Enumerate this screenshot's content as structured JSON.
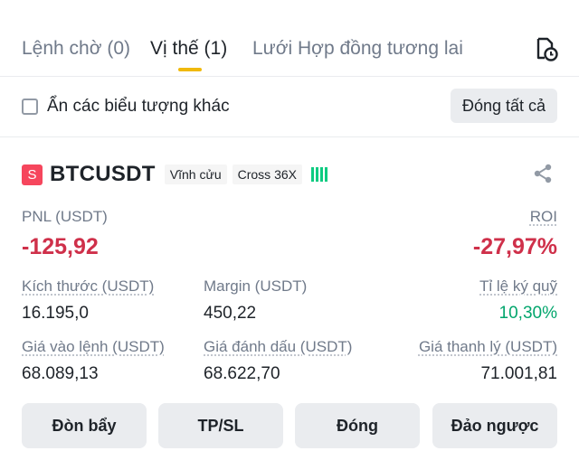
{
  "tabs": [
    {
      "label": "Lệnh chờ (0)",
      "active": false
    },
    {
      "label": "Vị thế (1)",
      "active": true
    },
    {
      "label": "Lưới Hợp đồng tương lai",
      "active": false
    }
  ],
  "hide_symbols": {
    "label": "Ẩn các biểu tượng khác",
    "checked": false
  },
  "close_all_label": "Đóng tất cả",
  "position": {
    "side_badge": "S",
    "symbol": "BTCUSDT",
    "contract_type": "Vĩnh cửu",
    "margin_mode": "Cross 36X",
    "pnl_label": "PNL (USDT)",
    "pnl_value": "-125,92",
    "roi_label": "ROI",
    "roi_value": "-27,97%",
    "size_label": "Kích thước (USDT)",
    "size_value": "16.195,0",
    "margin_label": "Margin (USDT)",
    "margin_value": "450,22",
    "margin_ratio_label": "Tỉ lệ ký quỹ",
    "margin_ratio_value": "10,30%",
    "entry_label": "Giá vào lệnh (USDT)",
    "entry_value": "68.089,13",
    "mark_label": "Giá đánh dấu (USDT)",
    "mark_value": "68.622,70",
    "liq_label": "Giá thanh lý (USDT)",
    "liq_value": "71.001,81"
  },
  "actions": {
    "leverage": "Đòn bẩy",
    "tpsl": "TP/SL",
    "close": "Đóng",
    "reverse": "Đảo ngược"
  },
  "colors": {
    "accent": "#f0b90b",
    "loss": "#cf304a",
    "profit": "#03a66d",
    "sell_badge": "#f6465d"
  }
}
